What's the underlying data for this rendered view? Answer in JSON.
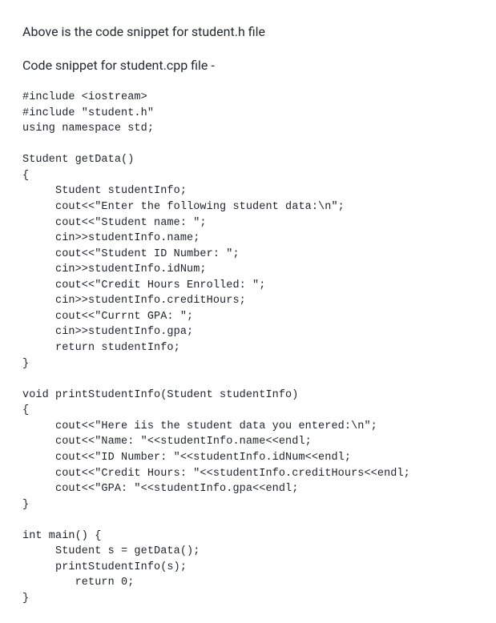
{
  "prose": {
    "p1": "Above is the code snippet for student.h file",
    "p2": "Code snippet for student.cpp file -"
  },
  "code": {
    "lines": [
      "#include <iostream>",
      "#include \"student.h\"",
      "using namespace std;",
      "",
      "Student getData()",
      "{",
      "     Student studentInfo;",
      "     cout<<\"Enter the following student data:\\n\";",
      "     cout<<\"Student name: \";",
      "     cin>>studentInfo.name;",
      "     cout<<\"Student ID Number: \";",
      "     cin>>studentInfo.idNum;",
      "     cout<<\"Credit Hours Enrolled: \";",
      "     cin>>studentInfo.creditHours;",
      "     cout<<\"Currnt GPA: \";",
      "     cin>>studentInfo.gpa;",
      "     return studentInfo;",
      "}",
      "",
      "void printStudentInfo(Student studentInfo)",
      "{",
      "     cout<<\"Here iis the student data you entered:\\n\";",
      "     cout<<\"Name: \"<<studentInfo.name<<endl;",
      "     cout<<\"ID Number: \"<<studentInfo.idNum<<endl;",
      "     cout<<\"Credit Hours: \"<<studentInfo.creditHours<<endl;",
      "     cout<<\"GPA: \"<<studentInfo.gpa<<endl;",
      "}",
      "",
      "int main() {",
      "     Student s = getData();",
      "     printStudentInfo(s);",
      "        return 0;",
      "}"
    ]
  }
}
